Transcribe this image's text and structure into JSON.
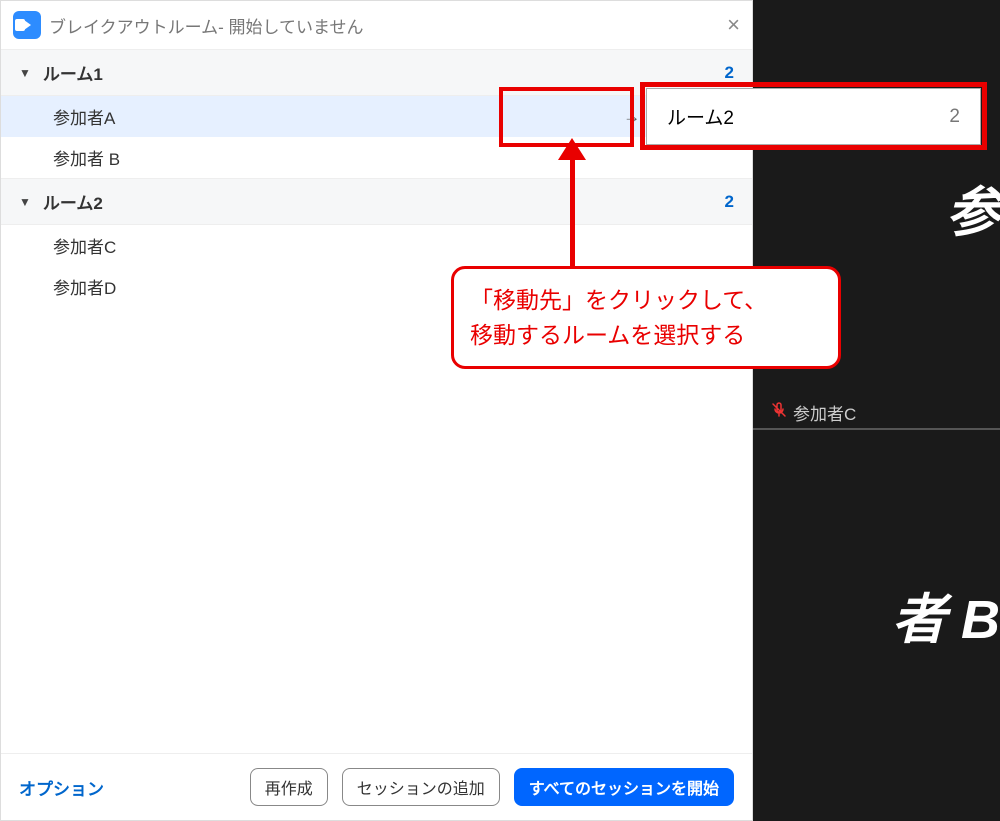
{
  "dialog": {
    "title": "ブレイクアウトルーム- 開始していません",
    "rooms": [
      {
        "name": "ルーム1",
        "count": "2",
        "participants": [
          "参加者A",
          "参加者 B"
        ]
      },
      {
        "name": "ルーム2",
        "count": "2",
        "participants": [
          "参加者C",
          "参加者D"
        ]
      }
    ],
    "move_label": "移動先",
    "options_label": "オプション",
    "recreate_label": "再作成",
    "add_session_label": "セッションの追加",
    "start_all_label": "すべてのセッションを開始"
  },
  "popup": {
    "room_name": "ルーム2",
    "count": "2"
  },
  "callout": {
    "line1": "「移動先」をクリックして、",
    "line2": "移動するルームを選択する"
  },
  "darkside": {
    "top_fragment": "参",
    "middle_name": "参加者C",
    "bottom_fragment": "者 B"
  }
}
